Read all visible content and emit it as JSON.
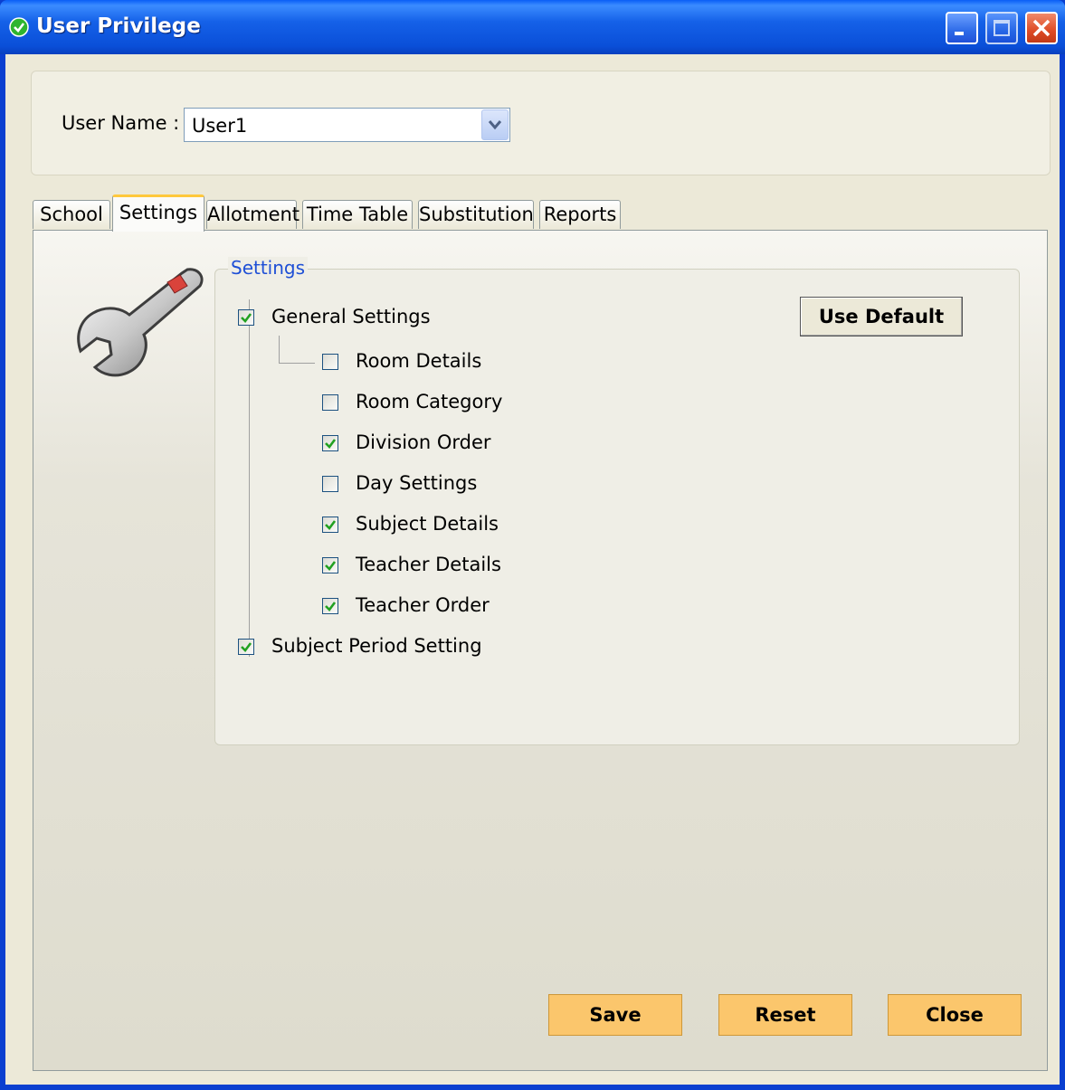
{
  "window": {
    "title": "User Privilege",
    "icon": "green-check-icon"
  },
  "user": {
    "label": "User Name :",
    "value": "User1"
  },
  "tabs": [
    {
      "label": "School"
    },
    {
      "label": "Settings",
      "active": true
    },
    {
      "label": "Allotment"
    },
    {
      "label": "Time Table"
    },
    {
      "label": "Substitution"
    },
    {
      "label": "Reports"
    }
  ],
  "settings_group": {
    "title": "Settings",
    "use_default": "Use Default",
    "items": [
      {
        "label": "General Settings",
        "checked": true,
        "level": 0
      },
      {
        "label": "Room Details",
        "checked": false,
        "level": 1
      },
      {
        "label": "Room Category",
        "checked": false,
        "level": 1
      },
      {
        "label": "Division Order",
        "checked": true,
        "level": 1
      },
      {
        "label": "Day Settings",
        "checked": false,
        "level": 1
      },
      {
        "label": "Subject Details",
        "checked": true,
        "level": 1
      },
      {
        "label": "Teacher Details",
        "checked": true,
        "level": 1
      },
      {
        "label": "Teacher Order",
        "checked": true,
        "level": 1
      },
      {
        "label": "Subject Period Setting",
        "checked": true,
        "level": 0
      }
    ]
  },
  "buttons": {
    "save": "Save",
    "reset": "Reset",
    "close": "Close"
  },
  "colors": {
    "accent_button": "#fbc66c",
    "group_title": "#1e4fd6",
    "check": "#21a121"
  }
}
